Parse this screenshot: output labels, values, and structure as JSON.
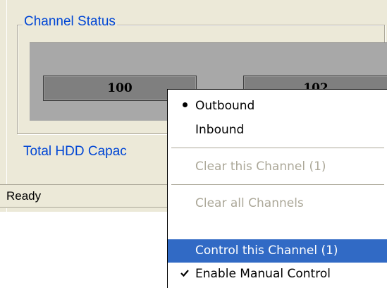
{
  "group": {
    "title": "Channel Status"
  },
  "counters": [
    "100",
    "102"
  ],
  "hdd_label": "Total HDD Capac",
  "status": {
    "text": "Ready"
  },
  "menu": {
    "items": [
      {
        "label": "Outbound",
        "mark": "bullet",
        "state": "checked"
      },
      {
        "label": "Inbound",
        "mark": "none",
        "state": "enabled"
      },
      {
        "label": "Clear this Channel (1)",
        "mark": "none",
        "state": "disabled"
      },
      {
        "label": "Clear all Channels",
        "mark": "none",
        "state": "disabled"
      },
      {
        "label": "Control this Channel (1)",
        "mark": "none",
        "state": "highlighted"
      },
      {
        "label": "Enable Manual Control",
        "mark": "checkmark",
        "state": "checked"
      }
    ]
  },
  "colors": {
    "accent_text": "#0046d5",
    "menu_highlight": "#316ac5",
    "disabled_text": "#aca899",
    "window_bg": "#ece9d8"
  },
  "icons": {
    "radio": "bullet-icon",
    "check": "checkmark-icon"
  }
}
